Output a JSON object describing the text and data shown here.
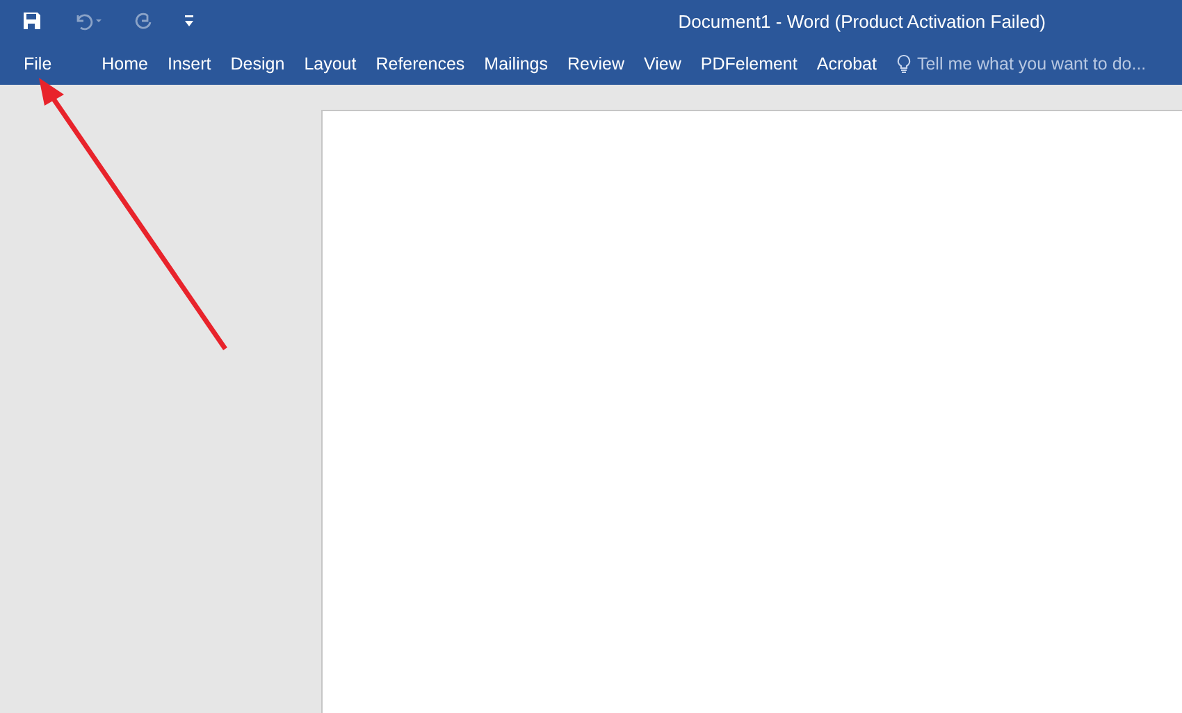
{
  "window": {
    "title": "Document1 - Word (Product Activation Failed)"
  },
  "quick_access": [
    {
      "kind": "save",
      "disabled": false
    },
    {
      "kind": "undo",
      "disabled": true
    },
    {
      "kind": "redo",
      "disabled": true
    },
    {
      "kind": "customize",
      "disabled": false
    }
  ],
  "tabs": [
    {
      "label": "File"
    },
    {
      "label": "Home"
    },
    {
      "label": "Insert"
    },
    {
      "label": "Design"
    },
    {
      "label": "Layout"
    },
    {
      "label": "References"
    },
    {
      "label": "Mailings"
    },
    {
      "label": "Review"
    },
    {
      "label": "View"
    },
    {
      "label": "PDFelement"
    },
    {
      "label": "Acrobat"
    }
  ],
  "tell_me": {
    "placeholder": "Tell me what you want to do..."
  }
}
